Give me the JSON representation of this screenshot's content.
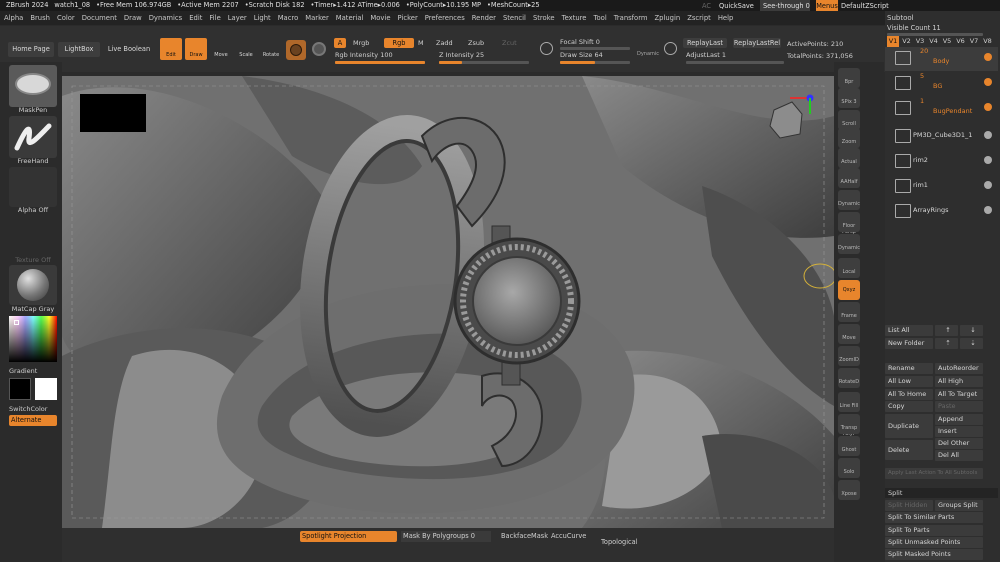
{
  "title_bar": {
    "items": [
      "ZBrush 2024",
      "watch1_08",
      "•Free Mem 106.974GB",
      "•Active Mem 2207",
      "•Scratch Disk 182",
      "•Timer▸1.412 ATime▸0.006",
      "•PolyCount▸10.195 MP",
      "•MeshCount▸25"
    ],
    "ac": "AC",
    "quicksave": "QuickSave",
    "see_through": "See-through 0",
    "menus": "Menus",
    "default_zscript": "DefaultZScript"
  },
  "menu": [
    "Alpha",
    "Brush",
    "Color",
    "Document",
    "Draw",
    "Dynamics",
    "Edit",
    "File",
    "Layer",
    "Light",
    "Macro",
    "Marker",
    "Material",
    "Movie",
    "Picker",
    "Preferences",
    "Render",
    "Stencil",
    "Stroke",
    "Texture",
    "Tool",
    "Transform",
    "Zplugin",
    "Zscript",
    "Help"
  ],
  "top": {
    "home_page": "Home Page",
    "lightbox": "LightBox",
    "live_boolean": "Live Boolean",
    "edit": "Edit",
    "draw": "Draw",
    "move": "Move",
    "scale": "Scale",
    "rotate": "Rotate",
    "a": "A",
    "mrgb": "Mrgb",
    "rgb": "Rgb",
    "m": "M",
    "zadd": "Zadd",
    "zsub": "Zsub",
    "zcut": "Zcut",
    "rgb_intensity": "Rgb Intensity 100",
    "z_intensity": "Z Intensity 25",
    "focal_shift": "Focal Shift 0",
    "draw_size": "Draw Size 64",
    "dynamic": "Dynamic",
    "replay_last": "ReplayLast",
    "replay_last_rel": "ReplayLastRel",
    "adjust_last": "AdjustLast 1",
    "active_points": "ActivePoints: 210",
    "total_points": "TotalPoints: 371,056",
    "rgb_intensity_value": 1.0,
    "z_intensity_value": 0.25,
    "draw_size_value": 0.5
  },
  "left": {
    "brush": "MaskPen",
    "stroke": "FreeHand",
    "alpha": "Alpha Off",
    "texture": "Texture Off",
    "material": "MatCap Gray",
    "gradient": "Gradient",
    "switch_color": "SwitchColor",
    "alternate": "Alternate"
  },
  "right_shelf": [
    "Bpr",
    "SPix 3",
    "Scroll",
    "Zoom",
    "Actual",
    "AAHalf",
    "Dynamic Persp",
    "Floor",
    "Dynamic L.Sym",
    "Local",
    "Qxyz",
    "Frame",
    "Move",
    "ZoomID",
    "RotateD",
    "Line Fill PolyF",
    "Transp",
    "Ghost",
    "Solo",
    "Xpose"
  ],
  "bottom": {
    "spotlight": "Spotlight Projection",
    "mask_polygroups": "Mask By Polygroups 0",
    "backface": "BackfaceMask",
    "accucurve": "AccuCurve",
    "topological": "Topological"
  },
  "subtool": {
    "title": "Subtool",
    "visible_count": "Visible Count 11",
    "versions": [
      "V1",
      "V2",
      "V3",
      "V4",
      "V5",
      "V6",
      "V7",
      "V8"
    ],
    "items": [
      {
        "count": "20",
        "name": "Body"
      },
      {
        "count": "5",
        "name": "BG"
      },
      {
        "count": "1",
        "name": "BugPendant"
      },
      {
        "count": "",
        "name": "PM3D_Cube3D1_1"
      },
      {
        "count": "",
        "name": "rim2"
      },
      {
        "count": "",
        "name": "rim1"
      },
      {
        "count": "",
        "name": "ArrayRings"
      }
    ],
    "list_all": "List All",
    "new_folder": "New Folder",
    "rename": "Rename",
    "auto_reorder": "AutoReorder",
    "all_low": "All Low",
    "all_high": "All High",
    "all_to_home": "All To Home",
    "all_to_target": "All To Target",
    "copy": "Copy",
    "paste": "Paste",
    "duplicate": "Duplicate",
    "append": "Append",
    "insert": "Insert",
    "delete": "Delete",
    "del_other": "Del Other",
    "del_all": "Del All",
    "apply_last": "Apply Last Action To All Subtools",
    "split": "Split",
    "split_hidden": "Split Hidden",
    "groups_split": "Groups Split",
    "split_similar": "Split To Similar Parts",
    "split_parts": "Split To Parts",
    "split_unmasked": "Split Unmasked Points",
    "split_masked": "Split Masked Points"
  }
}
